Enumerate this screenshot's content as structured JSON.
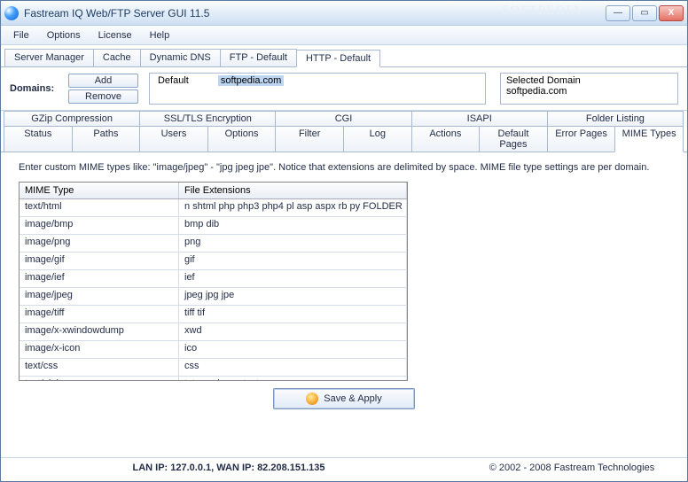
{
  "window": {
    "title": "Fastream IQ Web/FTP Server GUI 11.5",
    "watermark": "SOFTPEDIA"
  },
  "winbuttons": {
    "min": "—",
    "max": "▭",
    "close": "X"
  },
  "menu": [
    "File",
    "Options",
    "License",
    "Help"
  ],
  "toolbar_tabs": [
    {
      "label": "Server Manager",
      "active": false
    },
    {
      "label": "Cache",
      "active": false
    },
    {
      "label": "Dynamic DNS",
      "active": false
    },
    {
      "label": "FTP - Default",
      "active": false
    },
    {
      "label": "HTTP - Default",
      "active": true
    }
  ],
  "domains": {
    "label": "Domains:",
    "add": "Add",
    "remove": "Remove",
    "list": [
      {
        "text": "Default",
        "selected": false
      },
      {
        "text": "softpedia.com",
        "selected": true
      }
    ],
    "selected_title": "Selected Domain",
    "selected_value": "softpedia.com"
  },
  "sub_tabs_top": [
    "GZip Compression",
    "SSL/TLS Encryption",
    "CGI",
    "ISAPI",
    "Folder Listing"
  ],
  "sub_tabs_bottom": [
    "Status",
    "Paths",
    "Users",
    "Options",
    "Filter",
    "Log",
    "Actions",
    "Default Pages",
    "Error Pages",
    "MIME Types"
  ],
  "active_sub_tab": "MIME Types",
  "intro": "Enter custom MIME types like: \"image/jpeg\" - \"jpg jpeg jpe\". Notice that extensions are delimited by space. MIME file type settings are per domain.",
  "grid": {
    "headers": [
      "MIME Type",
      "File Extensions"
    ],
    "rows": [
      {
        "mime": "text/html",
        "ext": "n shtml php php3 php4 pl asp aspx rb py FOLDER"
      },
      {
        "mime": "image/bmp",
        "ext": "bmp dib"
      },
      {
        "mime": "image/png",
        "ext": "png"
      },
      {
        "mime": "image/gif",
        "ext": "gif"
      },
      {
        "mime": "image/ief",
        "ext": "ief"
      },
      {
        "mime": "image/jpeg",
        "ext": "jpeg jpg jpe"
      },
      {
        "mime": "image/tiff",
        "ext": "tiff tif"
      },
      {
        "mime": "image/x-xwindowdump",
        "ext": "xwd"
      },
      {
        "mime": "image/x-icon",
        "ext": "ico"
      },
      {
        "mime": "text/css",
        "ext": "css"
      },
      {
        "mime": "text/plain",
        "ext": "txt c cc h asc text"
      }
    ]
  },
  "save_label": "Save & Apply",
  "status": {
    "lan_wan": "LAN IP: 127.0.0.1, WAN IP: 82.208.151.135",
    "copyright": "© 2002 - 2008 Fastream Technologies"
  }
}
